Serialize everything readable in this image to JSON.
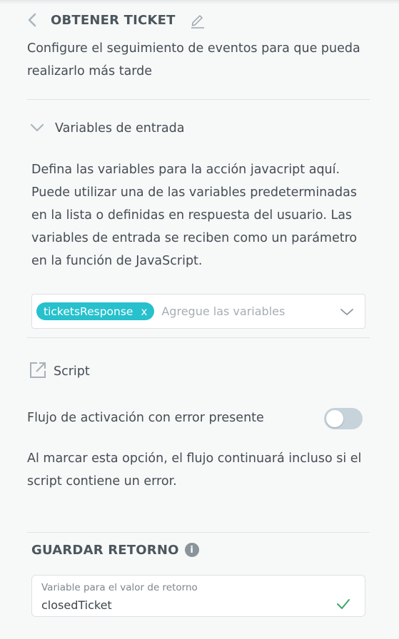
{
  "header": {
    "title": "OBTENER TICKET",
    "description": "Configure el seguimiento de eventos para que pueda realizarlo más tarde"
  },
  "input_variables": {
    "section_label": "Variables de entrada",
    "description": "Defina las variables para la acción javacript aquí. Puede utilizar una de las variables predeterminadas en la lista o definidas en respuesta del usuario. Las variables de entrada se reciben como un parámetro en la función de JavaScript.",
    "selected_chip": "ticketsResponse",
    "chip_remove": "x",
    "placeholder": "Agregue las variables"
  },
  "script": {
    "label": "Script",
    "icon": "external-link-icon"
  },
  "flow_on_error": {
    "label": "Flujo de activación con error presente",
    "enabled": false,
    "note": "Al marcar esta opción, el flujo continuará incluso si el script contiene un error."
  },
  "save_return": {
    "heading": "GUARDAR RETORNO",
    "info_glyph": "i",
    "field_label": "Variable para el valor de retorno",
    "field_value": "closedTicket"
  },
  "colors": {
    "accent": "#27c0cd",
    "check": "#3aa66a",
    "toggle_off": "#c6d3da"
  }
}
